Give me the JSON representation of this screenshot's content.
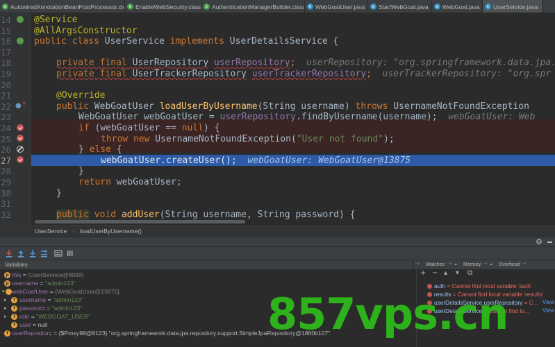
{
  "tabs": [
    {
      "label": "AutowiredAnnotationBeanPostProcessor.class",
      "icon": "class-file-icon",
      "active": false
    },
    {
      "label": "EnableWebSecurity.class",
      "icon": "class-file-icon",
      "active": false
    },
    {
      "label": "AuthenticationManagerBuilder.class",
      "icon": "class-file-icon",
      "active": false
    },
    {
      "label": "WebGoatUser.java",
      "icon": "java-class-icon",
      "active": false
    },
    {
      "label": "StartWebGoat.java",
      "icon": "java-class-icon",
      "active": false
    },
    {
      "label": "WebGoat.java",
      "icon": "java-class-icon",
      "active": false
    },
    {
      "label": "UserService.java",
      "icon": "java-class-icon",
      "active": true
    }
  ],
  "tab_close": "×",
  "editor": {
    "line_numbers": [
      "14",
      "15",
      "16",
      "17",
      "18",
      "19",
      "20",
      "21",
      "22",
      "23",
      "24",
      "25",
      "26",
      "27",
      "28",
      "29",
      "30",
      "31",
      "32"
    ],
    "code": {
      "l14": "@Service",
      "l15": "@AllArgsConstructor",
      "l16_public": "public",
      "l16_class": "class",
      "l16_name": " UserService ",
      "l16_implements": "implements",
      "l16_iface": " UserDetailsService {",
      "l18_mods": "private final",
      "l18_type": " UserRepository",
      "l18_field": "userRepository",
      "l18_semi": ";",
      "l18_hint": "userRepository: \"org.springframework.data.jpa.",
      "l19_mods": "private final",
      "l19_type": " UserTrackerRepository",
      "l19_field": "userTrackerRepository",
      "l19_semi": ";",
      "l19_hint": "userTrackerRepository: \"org.spr",
      "l21": "@Override",
      "l22_public": "public",
      "l22_type": " WebGoatUser ",
      "l22_method": "loadUserByUsername",
      "l22_params": "(String username) ",
      "l22_throws": "throws",
      "l22_exc": " UsernameNotFoundException ",
      "l23_a": "WebGoatUser webGoatUser = ",
      "l23_field": "userRepository",
      "l23_b": ".findByUsername(username);",
      "l23_hint": "webGoatUser: Web",
      "l24_if": "if",
      "l24_a": " (webGoatUser == ",
      "l24_null": "null",
      "l24_b": ") {",
      "l25_throw": "throw new",
      "l25_a": " UsernameNotFoundException(",
      "l25_str": "\"User not found\"",
      "l25_b": ");",
      "l26_a": "} ",
      "l26_else": "else",
      "l26_b": " {",
      "l27": "webGoatUser.createUser();",
      "l27_hint": "webGoatUser: WebGoatUser@13875",
      "l28": "}",
      "l29_return": "return",
      "l29_a": " webGoatUser;",
      "l30": "}",
      "l32_public": "public",
      "l32_void": "void",
      "l32_method": "addUser",
      "l32_a": "(String username, String password) {"
    }
  },
  "breadcrumb": {
    "items": [
      "UserService",
      "loadUserByUsername()"
    ],
    "separator": "›"
  },
  "debug": {
    "gear_glyph": "⚙",
    "toolbar_icons": [
      "step-over-icon",
      "step-into-icon",
      "force-step-into-icon",
      "step-out-icon",
      "run-to-cursor-icon",
      "evaluate-expression-icon",
      "more-icon"
    ]
  },
  "variables": {
    "title": "Variables",
    "rows": [
      {
        "arrow": "",
        "icon": "p",
        "name": "this",
        "value": "{UserService@8099}",
        "value_kind": "ref",
        "indent": 0
      },
      {
        "arrow": "",
        "icon": "p",
        "name": "username",
        "value": "\"admin123\"",
        "value_kind": "str",
        "indent": 0
      },
      {
        "arrow": "▾",
        "icon": "",
        "name": "webGoatUser",
        "value": "{WebGoatUser@13875}",
        "value_kind": "ref",
        "indent": 0
      },
      {
        "arrow": "▸",
        "icon": "f",
        "name": "username",
        "value": "\"admin123\"",
        "value_kind": "str",
        "indent": 1
      },
      {
        "arrow": "▸",
        "icon": "f",
        "name": "password",
        "value": "\"admin123\"",
        "value_kind": "str",
        "indent": 1
      },
      {
        "arrow": "▸",
        "icon": "f",
        "name": "role",
        "value": "\"WEBGOAT_USER\"",
        "value_kind": "str",
        "indent": 1
      },
      {
        "arrow": "",
        "icon": "f",
        "name": "user",
        "value": "null",
        "value_kind": "plain",
        "indent": 1
      },
      {
        "arrow": "",
        "icon": "",
        "name": "userRepository",
        "value": "{$Proxy98@8123} \"org.springframework.data.jpa.repository.support.SimpleJpaRepository@1860b107\"",
        "value_kind": "mixed",
        "indent": 0
      }
    ]
  },
  "watches": {
    "tabs": [
      "Watches",
      "Memory",
      "Overhead"
    ],
    "toolbar": [
      "+",
      "−",
      "▴",
      "▾",
      "⧉"
    ],
    "rows": [
      {
        "name": "auth",
        "message": " = Cannot find local variable 'auth'",
        "view": ""
      },
      {
        "name": "results",
        "message": " = Cannot find local variable 'results'",
        "view": ""
      },
      {
        "name": "userDetailsService.userRepository",
        "message": " = C...",
        "view": "View"
      },
      {
        "name": "userDetailsService",
        "message": " = Cannot find lo...",
        "view": "View"
      }
    ]
  },
  "watermark": "857vps.cn"
}
